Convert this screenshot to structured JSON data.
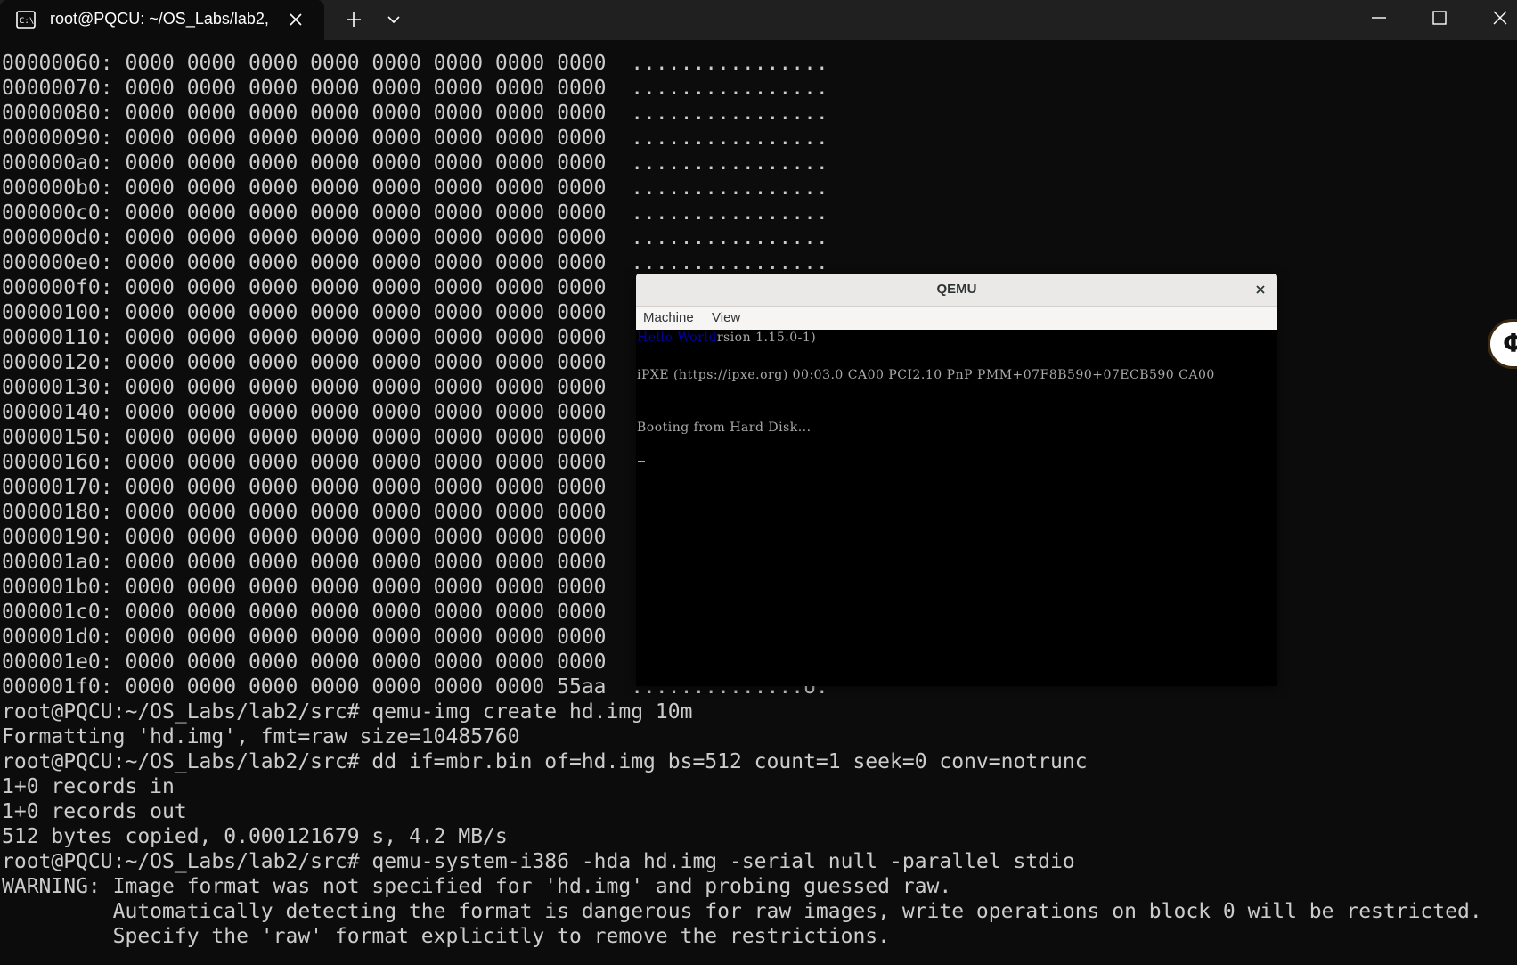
{
  "tab": {
    "title": "root@PQCU: ~/OS_Labs/lab2,",
    "icon": "terminal-icon"
  },
  "terminal": {
    "lines": [
      "00000060: 0000 0000 0000 0000 0000 0000 0000 0000  ................",
      "00000070: 0000 0000 0000 0000 0000 0000 0000 0000  ................",
      "00000080: 0000 0000 0000 0000 0000 0000 0000 0000  ................",
      "00000090: 0000 0000 0000 0000 0000 0000 0000 0000  ................",
      "000000a0: 0000 0000 0000 0000 0000 0000 0000 0000  ................",
      "000000b0: 0000 0000 0000 0000 0000 0000 0000 0000  ................",
      "000000c0: 0000 0000 0000 0000 0000 0000 0000 0000  ................",
      "000000d0: 0000 0000 0000 0000 0000 0000 0000 0000  ................",
      "000000e0: 0000 0000 0000 0000 0000 0000 0000 0000  ................",
      "000000f0: 0000 0000 0000 0000 0000 0000 0000 0000",
      "00000100: 0000 0000 0000 0000 0000 0000 0000 0000",
      "00000110: 0000 0000 0000 0000 0000 0000 0000 0000",
      "00000120: 0000 0000 0000 0000 0000 0000 0000 0000",
      "00000130: 0000 0000 0000 0000 0000 0000 0000 0000",
      "00000140: 0000 0000 0000 0000 0000 0000 0000 0000",
      "00000150: 0000 0000 0000 0000 0000 0000 0000 0000",
      "00000160: 0000 0000 0000 0000 0000 0000 0000 0000",
      "00000170: 0000 0000 0000 0000 0000 0000 0000 0000",
      "00000180: 0000 0000 0000 0000 0000 0000 0000 0000",
      "00000190: 0000 0000 0000 0000 0000 0000 0000 0000",
      "000001a0: 0000 0000 0000 0000 0000 0000 0000 0000",
      "000001b0: 0000 0000 0000 0000 0000 0000 0000 0000",
      "000001c0: 0000 0000 0000 0000 0000 0000 0000 0000",
      "000001d0: 0000 0000 0000 0000 0000 0000 0000 0000",
      "000001e0: 0000 0000 0000 0000 0000 0000 0000 0000",
      "000001f0: 0000 0000 0000 0000 0000 0000 0000 55aa  ..............U.",
      "root@PQCU:~/OS_Labs/lab2/src# qemu-img create hd.img 10m",
      "Formatting 'hd.img', fmt=raw size=10485760",
      "root@PQCU:~/OS_Labs/lab2/src# dd if=mbr.bin of=hd.img bs=512 count=1 seek=0 conv=notrunc",
      "1+0 records in",
      "1+0 records out",
      "512 bytes copied, 0.000121679 s, 4.2 MB/s",
      "root@PQCU:~/OS_Labs/lab2/src# qemu-system-i386 -hda hd.img -serial null -parallel stdio",
      "WARNING: Image format was not specified for 'hd.img' and probing guessed raw.",
      "         Automatically detecting the format is dangerous for raw images, write operations on block 0 will be restricted.",
      "         Specify the 'raw' format explicitly to remove the restrictions."
    ]
  },
  "qemu": {
    "title": "QEMU",
    "menu": {
      "machine": "Machine",
      "view": "View"
    },
    "screen": {
      "hello": "Hello World",
      "version_tail": "rsion 1.15.0-1)",
      "ipxe": "iPXE (https://ipxe.org) 00:03.0 CA00 PCI2.10 PnP PMM+07F8B590+07ECB590 CA00",
      "booting": "Booting from Hard Disk..."
    }
  },
  "colors": {
    "terminal_bg": "#0c0c0c",
    "terminal_fg": "#cccccc",
    "titlebar_bg": "#202020",
    "vga_fg": "#aaaaaa",
    "vga_blue": "#0000aa"
  }
}
